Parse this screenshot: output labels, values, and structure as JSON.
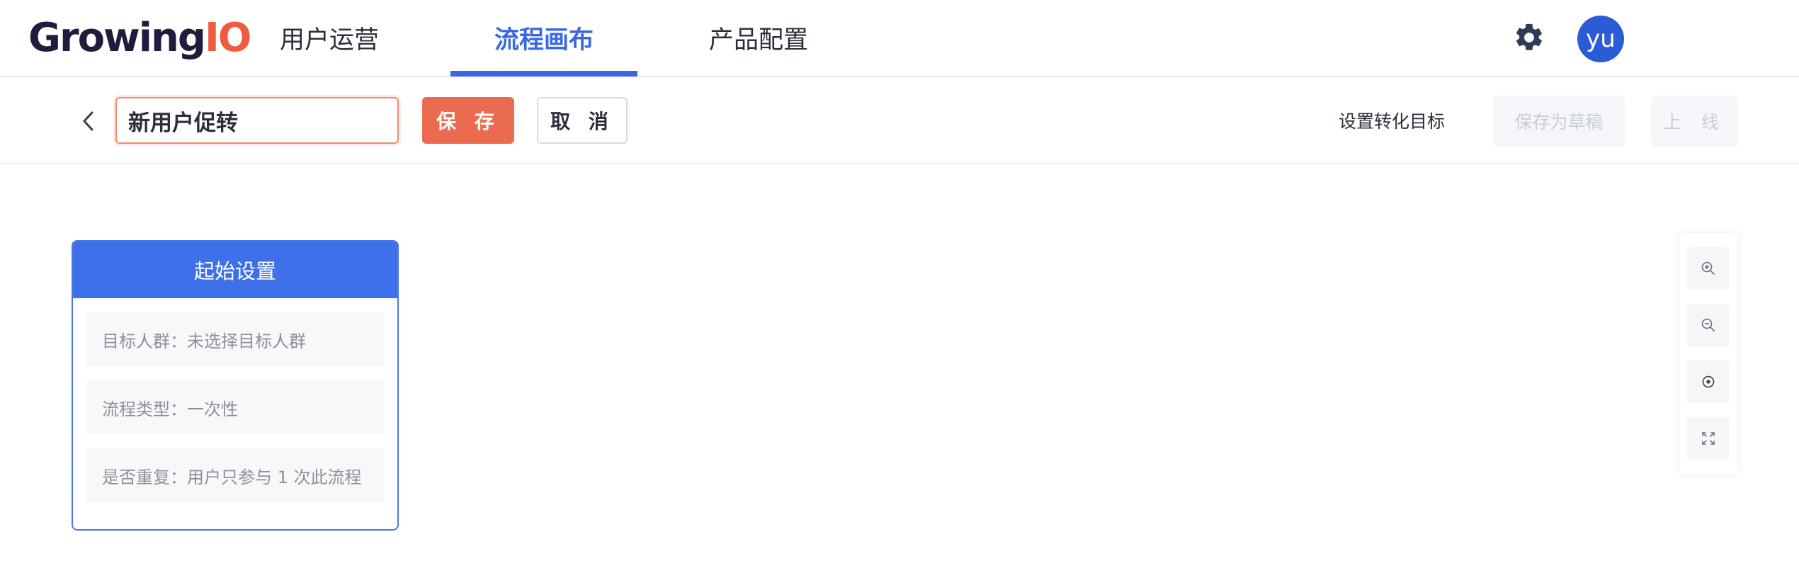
{
  "logo": {
    "text_main": "Growing",
    "text_accent": "IO"
  },
  "nav": {
    "tabs": [
      {
        "label": "用户运营"
      },
      {
        "label": "流程画布"
      },
      {
        "label": "产品配置"
      }
    ],
    "active_tab": "流程画布"
  },
  "header": {
    "avatar_initials": "yu",
    "settings_icon": "gear-icon"
  },
  "toolbar": {
    "flow_name": "新用户促转",
    "save_label": "保 存",
    "cancel_label": "取 消",
    "set_goal_label": "设置转化目标",
    "save_draft_label": "保存为草稿",
    "online_label": "上 线"
  },
  "start_node": {
    "title": "起始设置",
    "rows": [
      {
        "text": "目标人群：未选择目标人群"
      },
      {
        "text": "流程类型：一次性"
      },
      {
        "text": "是否重复：用户只参与 1 次此流程"
      }
    ]
  },
  "zoom_controls": [
    "zoom-in-icon",
    "zoom-out-icon",
    "locate-icon",
    "fit-screen-icon"
  ],
  "colors": {
    "brand_dark": "#1e1d3d",
    "brand_accent": "#f05a3f",
    "active_blue": "#3968e6",
    "save_button": "#eb6b50",
    "node_header": "#3e70ea"
  }
}
